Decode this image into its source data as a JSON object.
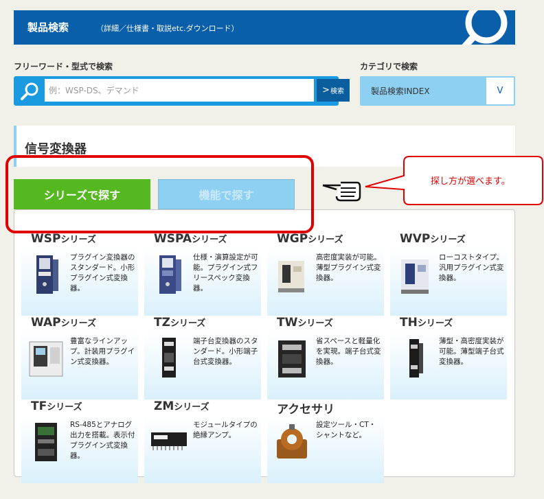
{
  "header": {
    "title": "製品検索",
    "subtitle": "（詳細／仕様書・取説etc.ダウンロード）"
  },
  "search": {
    "free_label": "フリーワード・型式で検索",
    "placeholder": "例：WSP-DS、デマンド",
    "button_label": "検索",
    "button_arrow": ">"
  },
  "category": {
    "label": "カテゴリで検索",
    "selected": "製品検索INDEX",
    "chevron": "V"
  },
  "section": {
    "title": "信号変換器"
  },
  "tabs": {
    "series": "シリーズで探す",
    "function": "機能で探す"
  },
  "callout": {
    "text": "探し方が選べます。"
  },
  "colors": {
    "header_blue": "#0a5fab",
    "search_blue": "#1a9ae0",
    "tab_green": "#55b820",
    "tab_light_blue": "#8dd0f2",
    "highlight_red": "#e00000"
  },
  "products": [
    {
      "name": "WSP",
      "suffix": "シリーズ",
      "desc": "プラグイン変換器のスタンダード。小形プラグイン式変換器。"
    },
    {
      "name": "WSPA",
      "suffix": "シリーズ",
      "desc": "仕様・演算設定が可能。プラグイン式フリースペック変換器。"
    },
    {
      "name": "WGP",
      "suffix": "シリーズ",
      "desc": "高密度実装が可能。薄型プラグイン式変換器。"
    },
    {
      "name": "WVP",
      "suffix": "シリーズ",
      "desc": "ローコストタイプ。汎用プラグイン式変換器。"
    },
    {
      "name": "WAP",
      "suffix": "シリーズ",
      "desc": "豊富なラインアップ。計装用プラグイン式変換器。"
    },
    {
      "name": "TZ",
      "suffix": "シリーズ",
      "desc": "端子台変換器のスタンダード。小形端子台式変換器。"
    },
    {
      "name": "TW",
      "suffix": "シリーズ",
      "desc": "省スペースと軽量化を実現。端子台式変換器。"
    },
    {
      "name": "TH",
      "suffix": "シリーズ",
      "desc": "薄型・高密度実装が可能。薄型端子台式変換器。"
    },
    {
      "name": "TF",
      "suffix": "シリーズ",
      "desc": "RS-485とアナログ出力を搭載。表示付プラグイン式変換器。"
    },
    {
      "name": "ZM",
      "suffix": "シリーズ",
      "desc": "モジュールタイプの絶縁アンプ。"
    },
    {
      "name": "アクセサリ",
      "suffix": "",
      "desc": "設定ツール・CT・シャントなど。"
    }
  ]
}
